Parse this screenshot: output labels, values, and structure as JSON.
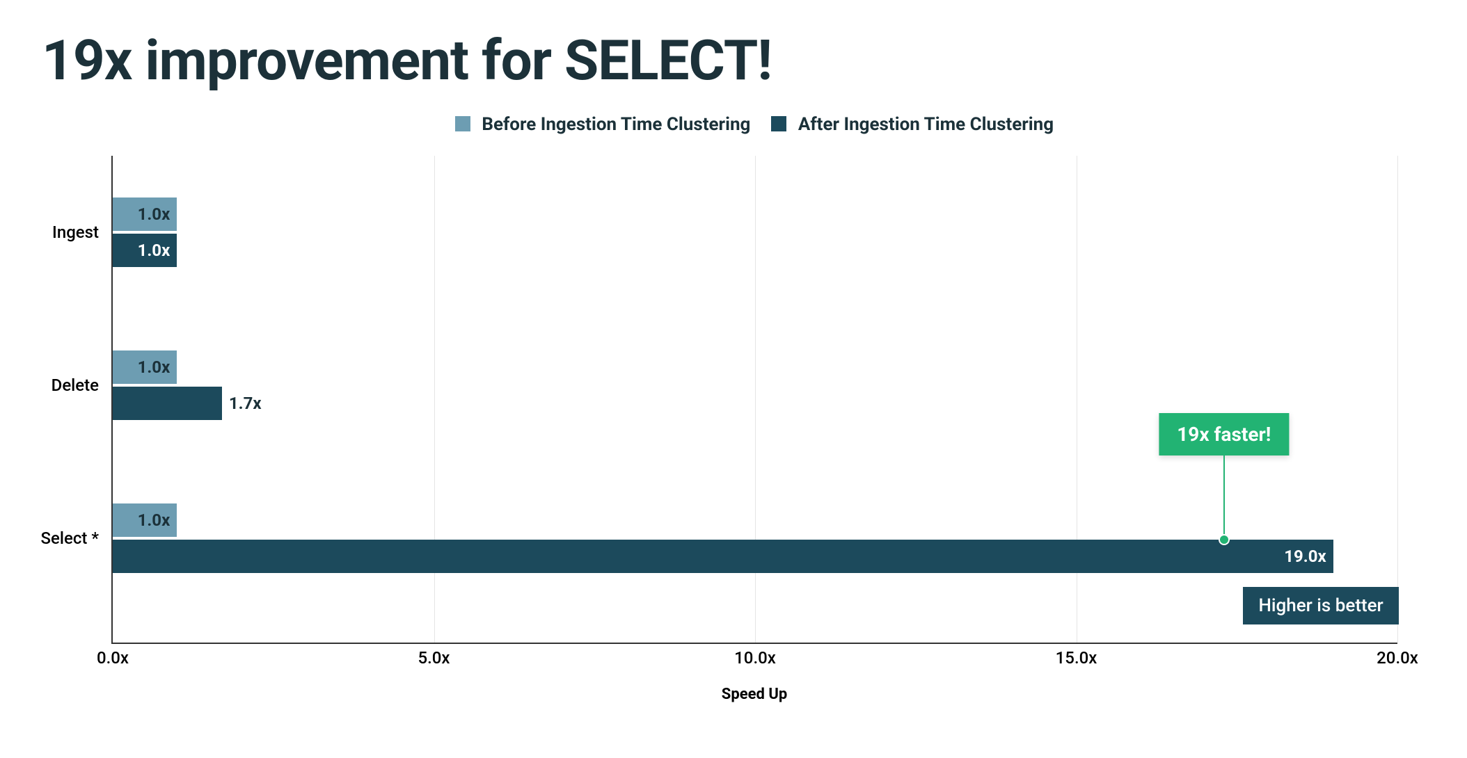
{
  "title": "19x improvement for SELECT!",
  "legend": {
    "before": "Before Ingestion Time Clustering",
    "after": "After Ingestion Time Clustering"
  },
  "xlabel": "Speed Up",
  "note": "Higher is better",
  "callout": "19x faster!",
  "xticks": [
    "0.0x",
    "5.0x",
    "10.0x",
    "15.0x",
    "20.0x"
  ],
  "categories": {
    "ingest": "Ingest",
    "delete": "Delete",
    "select": "Select *"
  },
  "bar_labels": {
    "ingest_before": "1.0x",
    "ingest_after": "1.0x",
    "delete_before": "1.0x",
    "delete_after": "1.7x",
    "select_before": "1.0x",
    "select_after": "19.0x"
  },
  "chart_data": {
    "type": "bar",
    "orientation": "horizontal",
    "title": "19x improvement for SELECT!",
    "xlabel": "Speed Up",
    "ylabel": "",
    "xlim": [
      0,
      20
    ],
    "categories": [
      "Ingest",
      "Delete",
      "Select *"
    ],
    "series": [
      {
        "name": "Before Ingestion Time Clustering",
        "values": [
          1.0,
          1.0,
          1.0
        ]
      },
      {
        "name": "After Ingestion Time Clustering",
        "values": [
          1.0,
          1.7,
          19.0
        ]
      }
    ],
    "annotations": [
      {
        "text": "19x faster!",
        "target": {
          "category": "Select *",
          "series": "After Ingestion Time Clustering"
        }
      },
      {
        "text": "Higher is better"
      }
    ],
    "legend_position": "top",
    "grid": true
  }
}
